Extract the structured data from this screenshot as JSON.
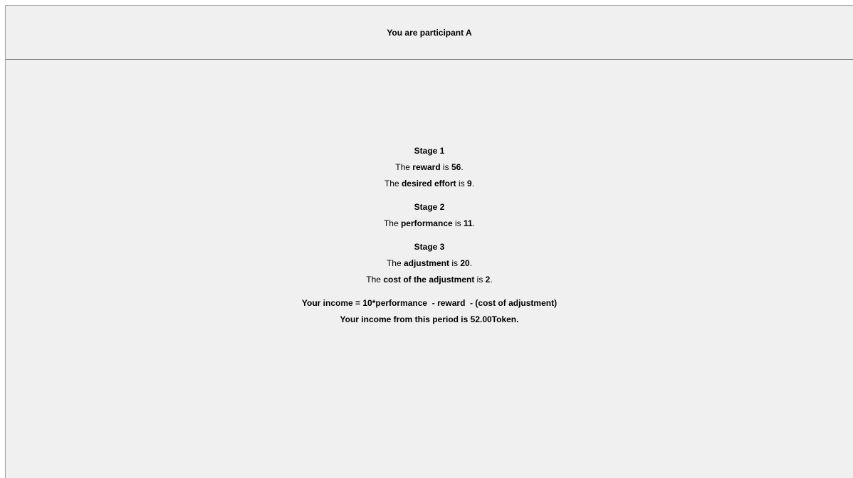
{
  "header": {
    "title": "You are participant A"
  },
  "stage1": {
    "heading": "Stage 1",
    "reward_prefix": "The ",
    "reward_label": "reward",
    "reward_mid": " is ",
    "reward_value": "56",
    "reward_suffix": ".",
    "effort_prefix": "The ",
    "effort_label": "desired effort",
    "effort_mid": " is ",
    "effort_value": "9",
    "effort_suffix": "."
  },
  "stage2": {
    "heading": "Stage 2",
    "performance_prefix": "The ",
    "performance_label": "performance",
    "performance_mid": " is ",
    "performance_value": "11",
    "performance_suffix": "."
  },
  "stage3": {
    "heading": "Stage 3",
    "adjustment_prefix": "The ",
    "adjustment_label": "adjustment",
    "adjustment_mid": " is ",
    "adjustment_value": "20",
    "adjustment_suffix": ".",
    "cost_prefix": "The ",
    "cost_label": "cost of the adjustment",
    "cost_mid": " is ",
    "cost_value": "2",
    "cost_suffix": "."
  },
  "income": {
    "formula": "Your income = 10*performance  - reward  - (cost of adjustment)",
    "result": "Your income from this period is 52.00Token."
  }
}
